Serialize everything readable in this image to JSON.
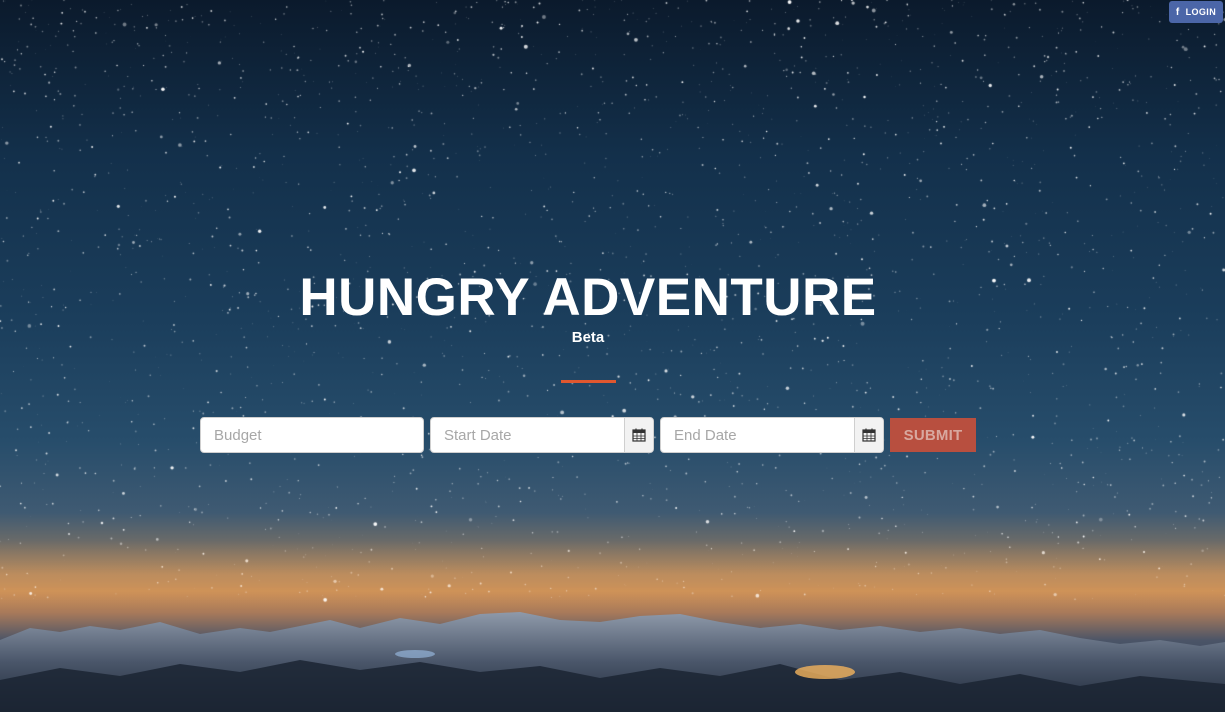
{
  "header": {
    "login_label": "LOGIN",
    "facebook_glyph": "f"
  },
  "hero": {
    "title": "HUNGRY ADVENTURE",
    "subtitle": "Beta"
  },
  "form": {
    "budget_placeholder": "Budget",
    "start_date_placeholder": "Start Date",
    "end_date_placeholder": "End Date",
    "submit_label": "SUBMIT"
  },
  "colors": {
    "accent": "#e0572f",
    "submit_bg": "#b84f3f",
    "facebook_blue": "#4b66a8"
  },
  "icons": [
    "facebook-icon",
    "calendar-icon"
  ]
}
